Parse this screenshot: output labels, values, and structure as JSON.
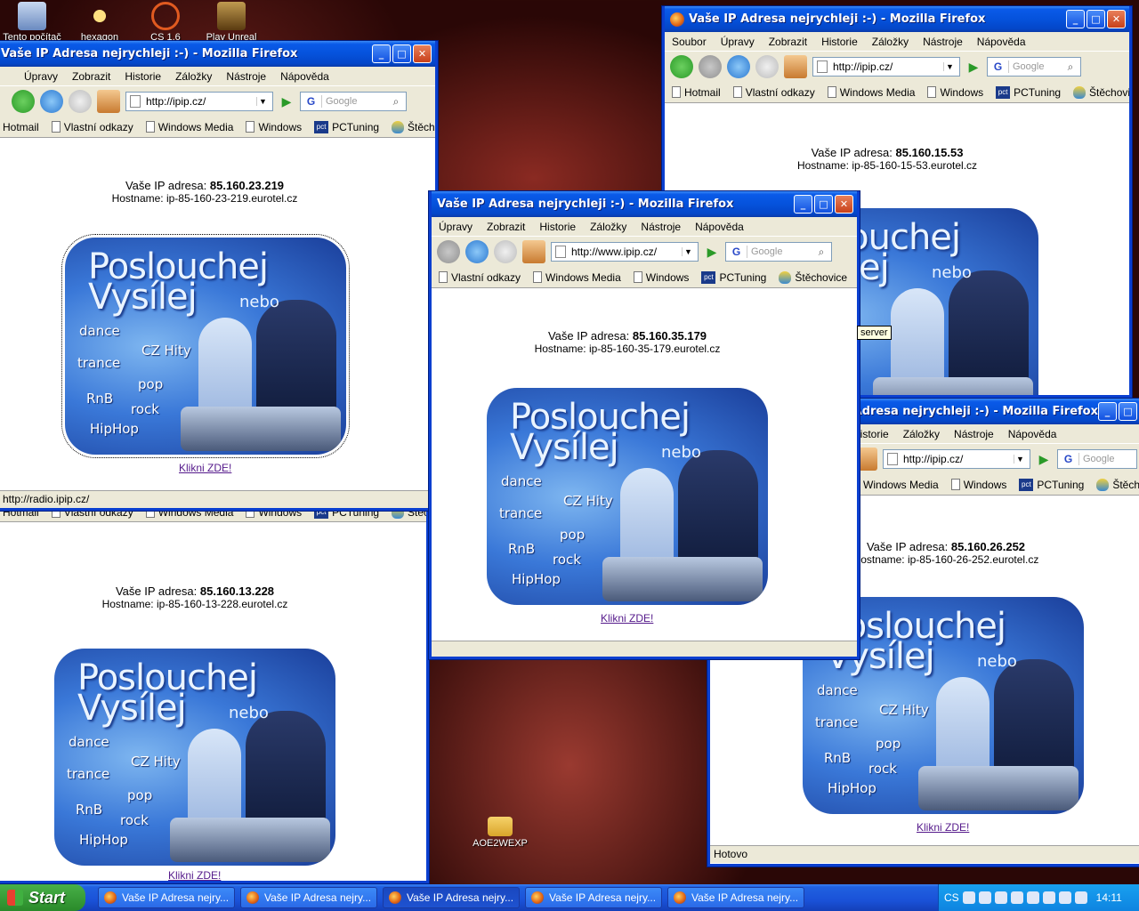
{
  "desktop": {
    "icons": [
      {
        "label": "Tento počítač"
      },
      {
        "label": "hexagon"
      },
      {
        "label": "CS 1.6"
      },
      {
        "label": "Play Unreal"
      },
      {
        "label": "AOE2WEXP"
      }
    ]
  },
  "browser": {
    "title": "Vaše IP Adresa nejrychleji :-) - Mozilla Firefox",
    "title_partial": "Vaše IP Adresa nejrychleji :-) - Mozilla Firefox",
    "menu": [
      "Soubor",
      "Úpravy",
      "Zobrazit",
      "Historie",
      "Záložky",
      "Nástroje",
      "Nápověda"
    ],
    "search_placeholder": "Google",
    "bookmarks": [
      "Hotmail",
      "Vlastní odkazy",
      "Windows Media",
      "Windows",
      "PCTuning",
      "Štěchovice"
    ],
    "ip_label": "Vaše IP adresa:",
    "hostname_label": "Hostname:",
    "banner": {
      "line1": "Poslouchej",
      "line2": "Vysílej",
      "nebo": "nebo",
      "genres": [
        "dance",
        "CZ Hity",
        "trance",
        "pop",
        "RnB",
        "rock",
        "HipHop"
      ]
    },
    "link_text": "Klikni ZDE!",
    "status_ready": "Hotovo",
    "status_link": "http://radio.ipip.cz/"
  },
  "windows": [
    {
      "url": "http://ipip.cz/",
      "ip": "85.160.15.53",
      "host": "ip-85-160-15-53.eurotel.cz"
    },
    {
      "url": "http://ipip.cz/",
      "ip": "85.160.23.219",
      "host": "ip-85-160-23-219.eurotel.cz"
    },
    {
      "url": "http://www.ipip.cz/",
      "ip": "85.160.35.179",
      "host": "ip-85-160-35-179.eurotel.cz"
    },
    {
      "url": "http://ipip.cz/",
      "ip": "85.160.26.252",
      "host": "ip-85-160-26-252.eurotel.cz"
    },
    {
      "url": "",
      "ip": "85.160.13.228",
      "host": "ip-85-160-13-228.eurotel.cz"
    }
  ],
  "tooltip": "server",
  "taskbar": {
    "start_label": "Start",
    "buttons": [
      "Vaše IP Adresa nejry...",
      "Vaše IP Adresa nejry...",
      "Vaše IP Adresa nejry...",
      "Vaše IP Adresa nejry...",
      "Vaše IP Adresa nejry..."
    ],
    "language": "CS",
    "clock": "14:11"
  }
}
